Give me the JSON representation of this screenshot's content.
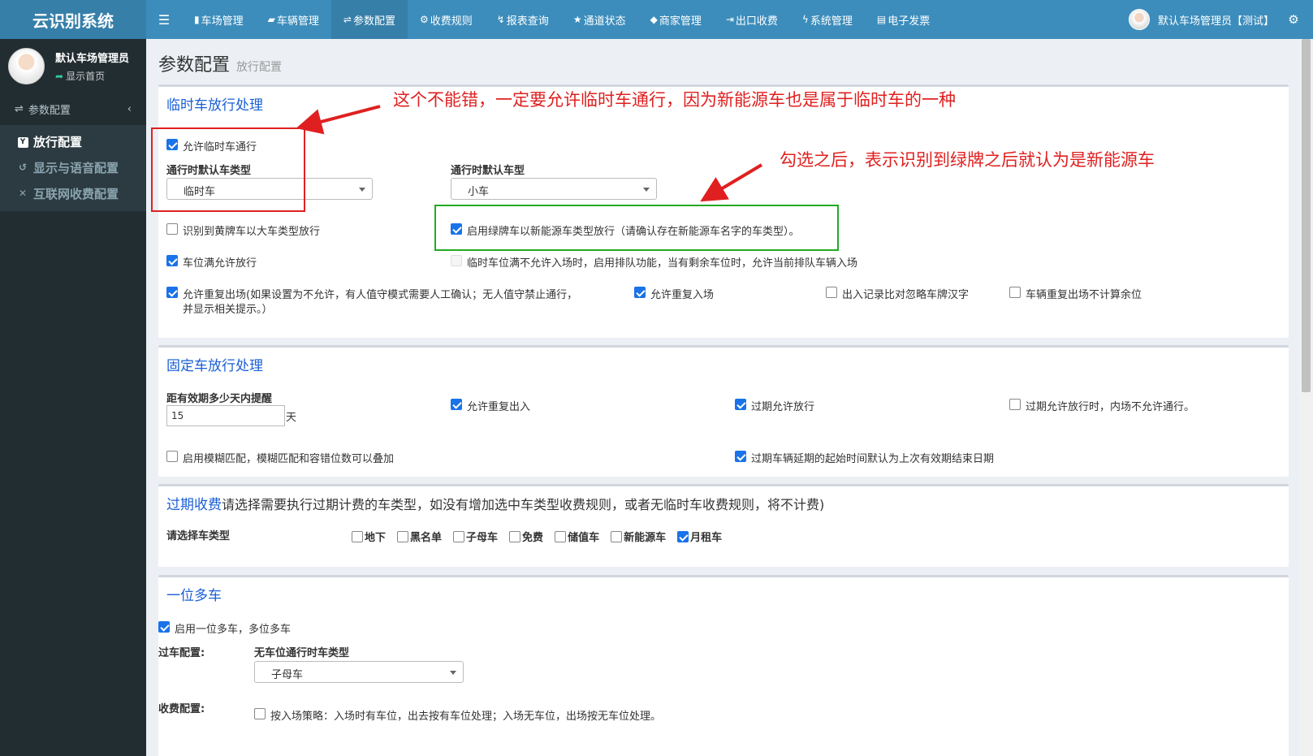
{
  "app": {
    "title": "云识别系统"
  },
  "nav": [
    {
      "icon": "▮",
      "label": "车场管理"
    },
    {
      "icon": "▰",
      "label": "车辆管理"
    },
    {
      "icon": "⇌",
      "label": "参数配置"
    },
    {
      "icon": "⚙",
      "label": "收费规则"
    },
    {
      "icon": "↯",
      "label": "报表查询"
    },
    {
      "icon": "★",
      "label": "通道状态"
    },
    {
      "icon": "◆",
      "label": "商家管理"
    },
    {
      "icon": "⇥",
      "label": "出口收费"
    },
    {
      "icon": "ϟ",
      "label": "系统管理"
    },
    {
      "icon": "▤",
      "label": "电子发票"
    }
  ],
  "user": {
    "name": "默认车场管理员【测试】",
    "short_name": "默认车场管理员",
    "home_link": "显示首页"
  },
  "sidebar": {
    "section": "参数配置",
    "items": [
      {
        "label": "放行配置"
      },
      {
        "label": "显示与语音配置"
      },
      {
        "label": "互联网收费配置"
      }
    ]
  },
  "page": {
    "title": "参数配置",
    "subtitle": "放行配置"
  },
  "temp": {
    "title": "临时车放行处理",
    "allow_temp": "允许临时车通行",
    "default_type_label": "通行时默认车类型",
    "default_type_value": "临时车",
    "default_car_label": "通行时默认车型",
    "default_car_value": "小车",
    "yellow_plate": "识别到黄牌车以大车类型放行",
    "green_plate": "启用绿牌车以新能源车类型放行（请确认存在新能源车名字的车类型）。",
    "full_allow": "车位满允许放行",
    "queue": "临时车位满不允许入场时，启用排队功能，当有剩余车位时，允许当前排队车辆入场",
    "repeat_exit_1": "允许重复出场(如果设置为不允许，有人值守模式需要人工确认；无人值守禁止通行，",
    "repeat_exit_2": "并显示相关提示。）",
    "repeat_enter": "允许重复入场",
    "ignore_chinese": "出入记录比对忽略车牌汉字",
    "no_count": "车辆重复出场不计算余位"
  },
  "fixed": {
    "title": "固定车放行处理",
    "remind_label": "距有效期多少天内提醒",
    "remind_value": "15",
    "remind_unit": "天",
    "repeat_io": "允许重复出入",
    "expired_allow": "过期允许放行",
    "expired_inner": "过期允许放行时，内场不允许通行。",
    "fuzzy": "启用模糊匹配，模糊匹配和容错位数可以叠加",
    "extend_start": "过期车辆延期的起始时间默认为上次有效期结束日期"
  },
  "overdue": {
    "title": "过期收费",
    "desc": "请选择需要执行过期计费的车类型，如没有增加选中车类型收费规则，或者无临时车收费规则，将不计费)",
    "select_label": "请选择车类型",
    "types": [
      {
        "label": "地下",
        "checked": false
      },
      {
        "label": "黑名单",
        "checked": false
      },
      {
        "label": "子母车",
        "checked": false
      },
      {
        "label": "免费",
        "checked": false
      },
      {
        "label": "储值车",
        "checked": false
      },
      {
        "label": "新能源车",
        "checked": false
      },
      {
        "label": "月租车",
        "checked": true
      }
    ]
  },
  "multi": {
    "title": "一位多车",
    "enable": "启用一位多车，多位多车",
    "pass_label": "过车配置:",
    "no_space_label": "无车位通行时车类型",
    "no_space_value": "子母车",
    "fee_label": "收费配置:",
    "strategy": "按入场策略：入场时有车位，出去按有车位处理；入场无车位，出场按无车位处理。"
  },
  "annotations": {
    "note1": "这个不能错，一定要允许临时车通行，因为新能源车也是属于临时车的一种",
    "note2": "勾选之后，表示识别到绿牌之后就认为是新能源车",
    "red": "#e02020",
    "green": "#22aa22"
  },
  "colors": {
    "header": "#3c8dbc",
    "logo": "#367fa9",
    "sidebar": "#222d32",
    "accent": "#1a73e8"
  }
}
